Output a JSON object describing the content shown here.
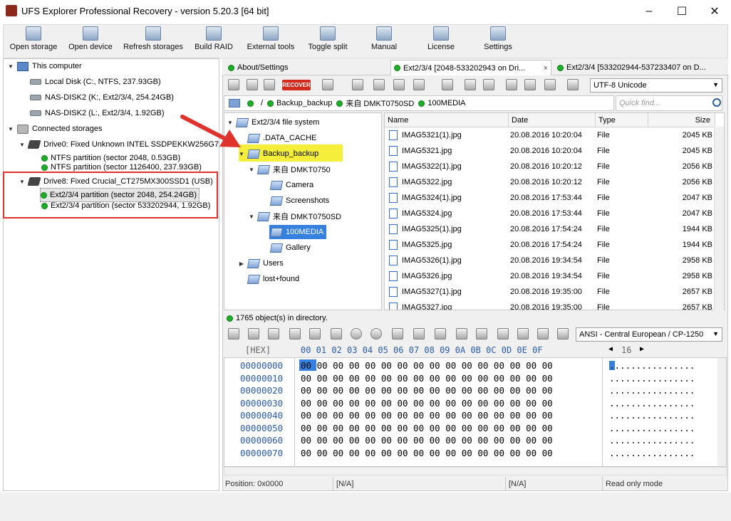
{
  "window": {
    "title": "UFS Explorer Professional Recovery - version 5.20.3 [64 bit]",
    "minimize": "–",
    "maximize": "☐",
    "close": "✕"
  },
  "toolbar": [
    {
      "label": "Open storage",
      "icon": "open-storage-icon"
    },
    {
      "label": "Open device",
      "icon": "open-device-icon"
    },
    {
      "label": "Refresh storages",
      "icon": "refresh-icon"
    },
    {
      "label": "Build RAID",
      "icon": "raid-icon"
    },
    {
      "label": "External tools",
      "icon": "tools-icon"
    },
    {
      "label": "Toggle split",
      "icon": "split-icon"
    },
    {
      "label": "Manual",
      "icon": "manual-icon"
    },
    {
      "label": "License",
      "icon": "license-icon"
    },
    {
      "label": "Settings",
      "icon": "settings-icon"
    }
  ],
  "storage_tree": {
    "this_computer": "This computer",
    "local_disks": [
      "Local Disk (C:, NTFS, 237.93GB)",
      "NAS-DISK2 (K:, Ext2/3/4, 254.24GB)",
      "NAS-DISK2 (L:, Ext2/3/4, 1.92GB)"
    ],
    "connected": "Connected storages",
    "drive0": "Drive0: Fixed Unknown INTEL SSDPEKKW256G7",
    "drive0_parts": [
      "NTFS partition (sector 2048, 0.53GB)",
      "NTFS partition (sector 1126400, 237.93GB)"
    ],
    "drive8": "Drive8: Fixed Crucial_CT275MX300SSD1 (USB)",
    "drive8_parts": [
      "Ext2/3/4 partition (sector 2048, 254.24GB)",
      "Ext2/3/4 partition (sector 533202944, 1.92GB)"
    ]
  },
  "tabs": [
    {
      "label": "About/Settings"
    },
    {
      "label": "Ext2/3/4 [2048-533202943 on Dri..."
    },
    {
      "label": "Ext2/3/4 [533202944-537233407 on D..."
    }
  ],
  "tab_close": "×",
  "encoding": "UTF-8 Unicode",
  "path": {
    "root": "/",
    "parts": [
      "Backup_backup",
      "来自 DMKT0750SD",
      "100MEDIA"
    ]
  },
  "quick_find_placeholder": "Quick find...",
  "folder_tree": {
    "root": "Ext2/3/4 file system",
    "data_cache": ".DATA_CACHE",
    "backup": "Backup_backup",
    "dmkt0750": "来自 DMKT0750",
    "camera": "Camera",
    "screenshots": "Screenshots",
    "dmkt0750sd": "来自 DMKT0750SD",
    "media": "100MEDIA",
    "gallery": "Gallery",
    "users": "Users",
    "lost": "lost+found"
  },
  "file_columns": [
    "Name",
    "Date",
    "Type",
    "Size"
  ],
  "files": [
    {
      "name": "IMAG5321(1).jpg",
      "date": "20.08.2016 10:20:04",
      "type": "File",
      "size": "2045 KB"
    },
    {
      "name": "IMAG5321.jpg",
      "date": "20.08.2016 10:20:04",
      "type": "File",
      "size": "2045 KB"
    },
    {
      "name": "IMAG5322(1).jpg",
      "date": "20.08.2016 10:20:12",
      "type": "File",
      "size": "2056 KB"
    },
    {
      "name": "IMAG5322.jpg",
      "date": "20.08.2016 10:20:12",
      "type": "File",
      "size": "2056 KB"
    },
    {
      "name": "IMAG5324(1).jpg",
      "date": "20.08.2016 17:53:44",
      "type": "File",
      "size": "2047 KB"
    },
    {
      "name": "IMAG5324.jpg",
      "date": "20.08.2016 17:53:44",
      "type": "File",
      "size": "2047 KB"
    },
    {
      "name": "IMAG5325(1).jpg",
      "date": "20.08.2016 17:54:24",
      "type": "File",
      "size": "1944 KB"
    },
    {
      "name": "IMAG5325.jpg",
      "date": "20.08.2016 17:54:24",
      "type": "File",
      "size": "1944 KB"
    },
    {
      "name": "IMAG5326(1).jpg",
      "date": "20.08.2016 19:34:54",
      "type": "File",
      "size": "2958 KB"
    },
    {
      "name": "IMAG5326.jpg",
      "date": "20.08.2016 19:34:54",
      "type": "File",
      "size": "2958 KB"
    },
    {
      "name": "IMAG5327(1).jpg",
      "date": "20.08.2016 19:35:00",
      "type": "File",
      "size": "2657 KB"
    },
    {
      "name": "IMAG5327.jpg",
      "date": "20.08.2016 19:35:00",
      "type": "File",
      "size": "2657 KB"
    }
  ],
  "dir_status": "1765 object(s) in directory.",
  "recover_label": "RECOVER",
  "hex_encoding": "ANSI - Central European / CP-1250",
  "hex_header": {
    "label": "[HEX]",
    "cols": "00 01 02 03 04 05 06 07 08 09 0A 0B 0C 0D 0E 0F",
    "width": "16"
  },
  "hex_rows": [
    {
      "addr": "00000000",
      "bytes": "00 00 00 00 00 00 00 00 00 00 00 00 00 00 00 00",
      "ascii": "................"
    },
    {
      "addr": "00000010",
      "bytes": "00 00 00 00 00 00 00 00 00 00 00 00 00 00 00 00",
      "ascii": "................"
    },
    {
      "addr": "00000020",
      "bytes": "00 00 00 00 00 00 00 00 00 00 00 00 00 00 00 00",
      "ascii": "................"
    },
    {
      "addr": "00000030",
      "bytes": "00 00 00 00 00 00 00 00 00 00 00 00 00 00 00 00",
      "ascii": "................"
    },
    {
      "addr": "00000040",
      "bytes": "00 00 00 00 00 00 00 00 00 00 00 00 00 00 00 00",
      "ascii": "................"
    },
    {
      "addr": "00000050",
      "bytes": "00 00 00 00 00 00 00 00 00 00 00 00 00 00 00 00",
      "ascii": "................"
    },
    {
      "addr": "00000060",
      "bytes": "00 00 00 00 00 00 00 00 00 00 00 00 00 00 00 00",
      "ascii": "................"
    },
    {
      "addr": "00000070",
      "bytes": "00 00 00 00 00 00 00 00 00 00 00 00 00 00 00 00",
      "ascii": "................"
    }
  ],
  "status": {
    "position": "Position: 0x0000",
    "na1": "[N/A]",
    "na2": "[N/A]",
    "mode": "Read only mode"
  },
  "colors": {
    "highlight": "#f5ef3c",
    "selection": "#3680e0",
    "annotation": "#e0332d",
    "ok": "#1cae27"
  }
}
